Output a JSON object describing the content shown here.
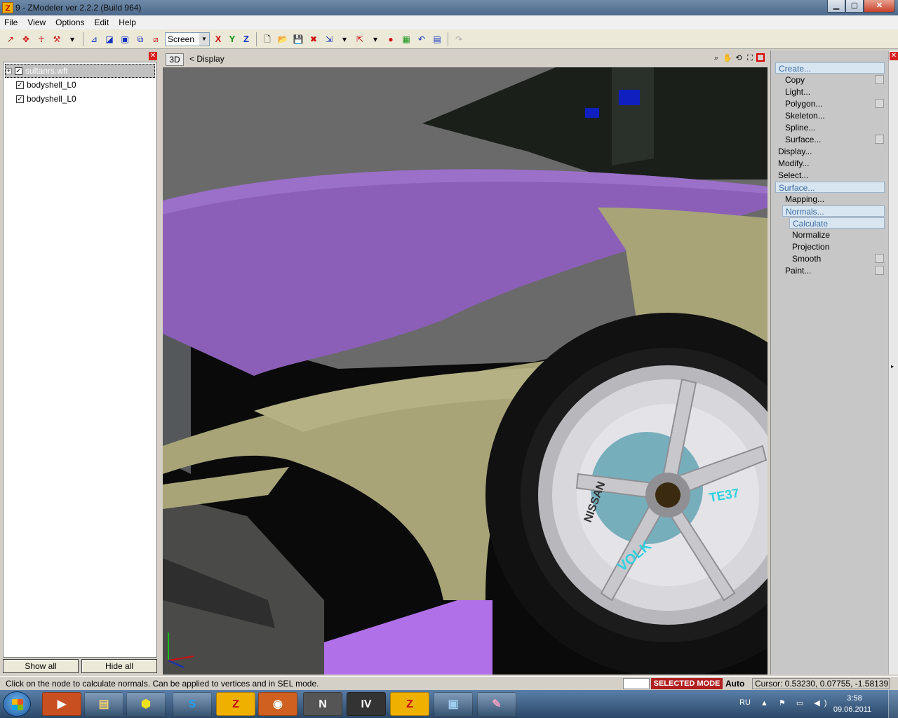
{
  "window": {
    "title": "9 - ZModeler ver 2.2.2 (Build 964)",
    "app_icon": "Z",
    "minimize": "▁",
    "maximize": "▢",
    "close": "✕"
  },
  "menu": [
    {
      "label": "File"
    },
    {
      "label": "View"
    },
    {
      "label": "Options"
    },
    {
      "label": "Edit"
    },
    {
      "label": "Help"
    }
  ],
  "toolbar": {
    "mode_select": "Screen",
    "axis_x": "X",
    "axis_y": "Y",
    "axis_z": "Z"
  },
  "tree": [
    {
      "label": "sultanrs.wft",
      "checked": true,
      "expander": "+"
    },
    {
      "label": "bodyshell_L0",
      "checked": true
    },
    {
      "label": "bodyshell_L0",
      "checked": true
    }
  ],
  "left_buttons": {
    "show_all": "Show all",
    "hide_all": "Hide all"
  },
  "viewport": {
    "tag": "3D",
    "label": "<  Display"
  },
  "right_menu": [
    {
      "label": "Create...",
      "level": 0,
      "hl": true
    },
    {
      "label": "Copy",
      "level": 1,
      "check": true
    },
    {
      "label": "Light...",
      "level": 1
    },
    {
      "label": "Polygon...",
      "level": 1,
      "check": true
    },
    {
      "label": "Skeleton...",
      "level": 1
    },
    {
      "label": "Spline...",
      "level": 1
    },
    {
      "label": "Surface...",
      "level": 1,
      "check": true
    },
    {
      "label": "Display...",
      "level": 0
    },
    {
      "label": "Modify...",
      "level": 0
    },
    {
      "label": "Select...",
      "level": 0
    },
    {
      "label": "Surface...",
      "level": 0,
      "hl": true
    },
    {
      "label": "Mapping...",
      "level": 1
    },
    {
      "label": "Normals...",
      "level": 1,
      "hl": true
    },
    {
      "label": "Calculate",
      "level": 2,
      "hl": true
    },
    {
      "label": "Normalize",
      "level": 2
    },
    {
      "label": "Projection",
      "level": 2
    },
    {
      "label": "Smooth",
      "level": 2,
      "check": true
    },
    {
      "label": "Paint...",
      "level": 1,
      "check": true
    }
  ],
  "status": {
    "message": "Click on the node to calculate normals. Can be applied to vertices and in SEL mode.",
    "mode": "SELECTED MODE",
    "auto": "Auto",
    "cursor": "Cursor: 0.53230, 0.07755, -1.58139"
  },
  "taskbar": {
    "apps": [
      {
        "name": "media-player",
        "glyph": "▶"
      },
      {
        "name": "explorer",
        "glyph": "▤"
      },
      {
        "name": "app-gta",
        "glyph": "⬢"
      },
      {
        "name": "skype",
        "glyph": "S"
      },
      {
        "name": "zmodeler-1",
        "glyph": "Z"
      },
      {
        "name": "firefox",
        "glyph": "◉"
      },
      {
        "name": "app-n",
        "glyph": "N"
      },
      {
        "name": "app-iv",
        "glyph": "IV"
      },
      {
        "name": "zmodeler-2",
        "glyph": "Z"
      },
      {
        "name": "picture-viewer",
        "glyph": "▣"
      },
      {
        "name": "paint",
        "glyph": "✎"
      }
    ],
    "lang": "RU",
    "tray_icons": "▲ ⚑ ▭ ◀)",
    "time": "3:58",
    "date": "09.06.2011"
  },
  "colors": {
    "mode_badge": "#b02020",
    "viewport_bg": "#6c6c6c",
    "hood": "#8b5fb8",
    "fender": "#a8a478",
    "wheel": "#c8c8cc",
    "accent_cyan": "#2fd0e0"
  }
}
